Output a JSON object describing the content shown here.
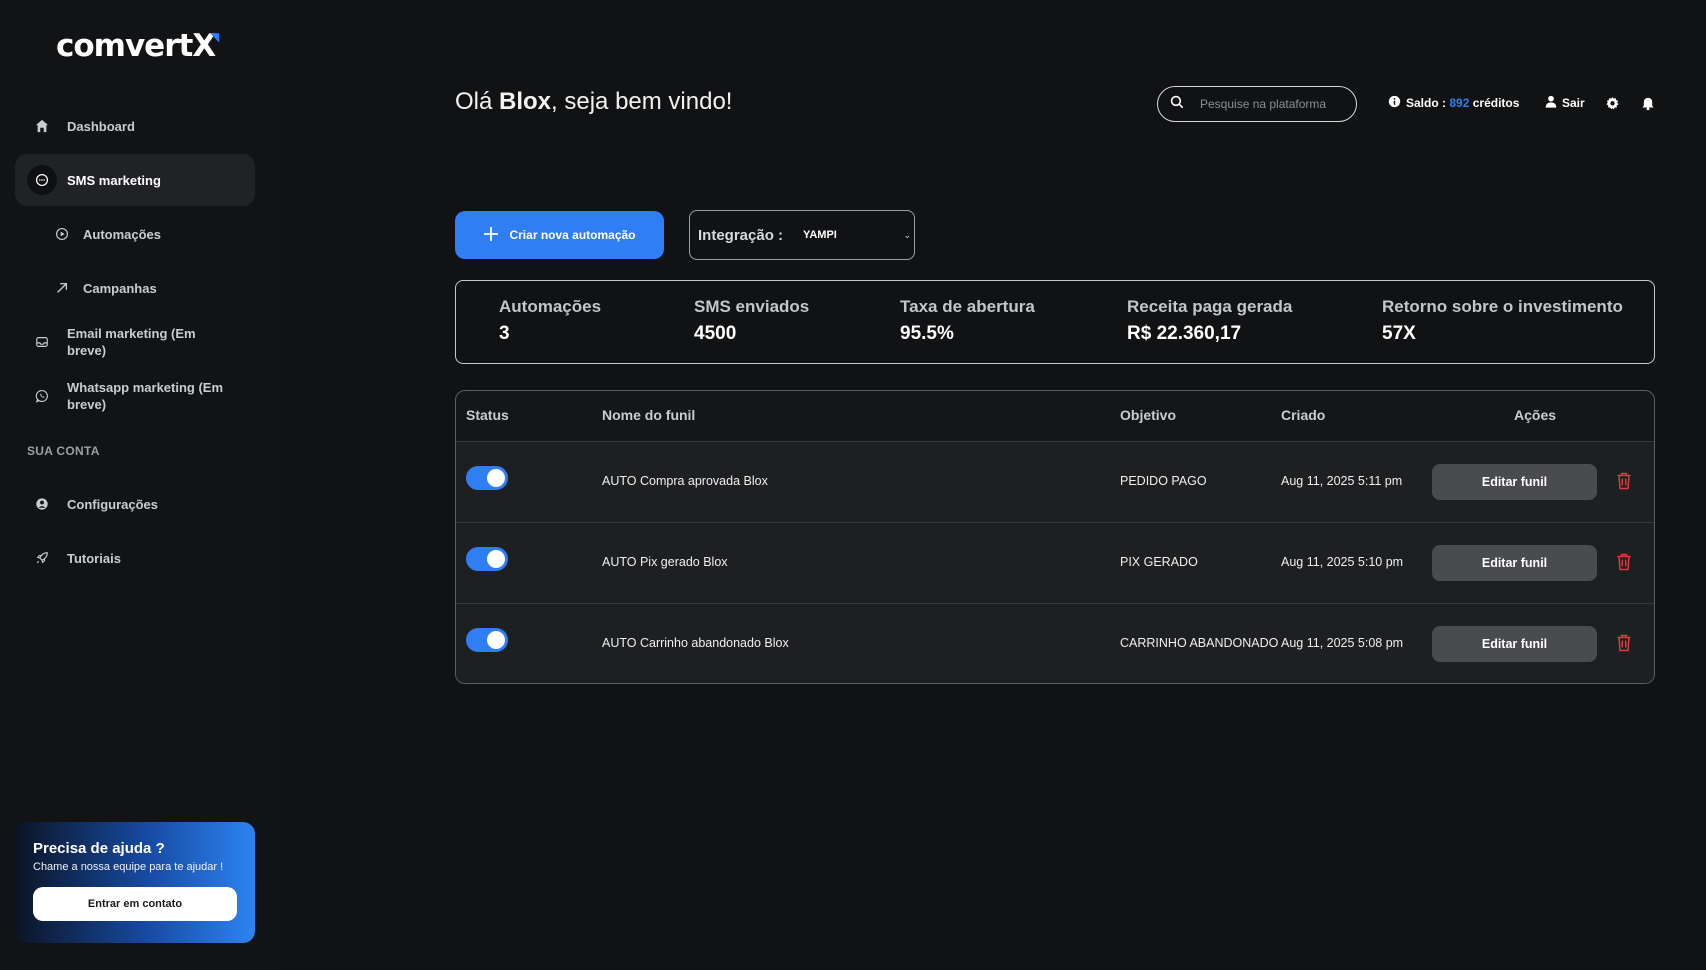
{
  "brand": {
    "logo": "comvert",
    "logo_x": "X"
  },
  "sidebar": {
    "items": [
      {
        "label": "Dashboard",
        "icon": "home-icon"
      },
      {
        "label": "SMS marketing",
        "icon": "chat-icon"
      },
      {
        "label": "Automações",
        "icon": "play-icon"
      },
      {
        "label": "Campanhas",
        "icon": "arrow-up-right-icon"
      },
      {
        "label": "Email marketing (Em breve)",
        "icon": "inbox-icon"
      },
      {
        "label": "Whatsapp marketing (Em breve)",
        "icon": "whatsapp-icon"
      },
      {
        "label": "Configurações",
        "icon": "user-circle-icon"
      },
      {
        "label": "Tutoriais",
        "icon": "rocket-icon"
      }
    ],
    "section_account": "SUA CONTA",
    "help": {
      "title": "Precisa de ajuda ?",
      "text": "Chame a nossa equipe para te ajudar !",
      "button": "Entrar em contato"
    }
  },
  "header": {
    "greeting_prefix": "Olá ",
    "user_name": "Blox",
    "greeting_suffix": ", seja bem vindo!",
    "search_placeholder": "Pesquise na plataforma",
    "saldo_label": "Saldo : ",
    "saldo_value": "892",
    "saldo_unit": "créditos",
    "logout": "Sair"
  },
  "actions": {
    "create_label": "Criar nova automação",
    "integration_label": "Integração :",
    "integration_value": "YAMPI"
  },
  "stats": [
    {
      "title": "Automações",
      "value": "3"
    },
    {
      "title": "SMS enviados",
      "value": "4500"
    },
    {
      "title": "Taxa de abertura",
      "value": "95.5%"
    },
    {
      "title": "Receita paga gerada",
      "value": "R$ 22.360,17"
    },
    {
      "title": "Retorno sobre o investimento",
      "value": "57X"
    }
  ],
  "table": {
    "headers": [
      "Status",
      "Nome do funil",
      "Objetivo",
      "Criado",
      "Ações"
    ],
    "rows": [
      {
        "active": true,
        "name": "AUTO Compra aprovada Blox",
        "objective": "PEDIDO PAGO",
        "created": "Aug 11, 2025 5:11 pm",
        "action": "Editar funil"
      },
      {
        "active": true,
        "name": "AUTO Pix gerado Blox",
        "objective": "PIX GERADO",
        "created": "Aug 11, 2025 5:10 pm",
        "action": "Editar funil"
      },
      {
        "active": true,
        "name": "AUTO Carrinho abandonado Blox",
        "objective": "CARRINHO ABANDONADO",
        "created": "Aug 11, 2025 5:08 pm",
        "action": "Editar funil"
      }
    ]
  },
  "colors": {
    "accent": "#2f7ef3",
    "danger": "#e03b3b",
    "bg": "#111214"
  }
}
